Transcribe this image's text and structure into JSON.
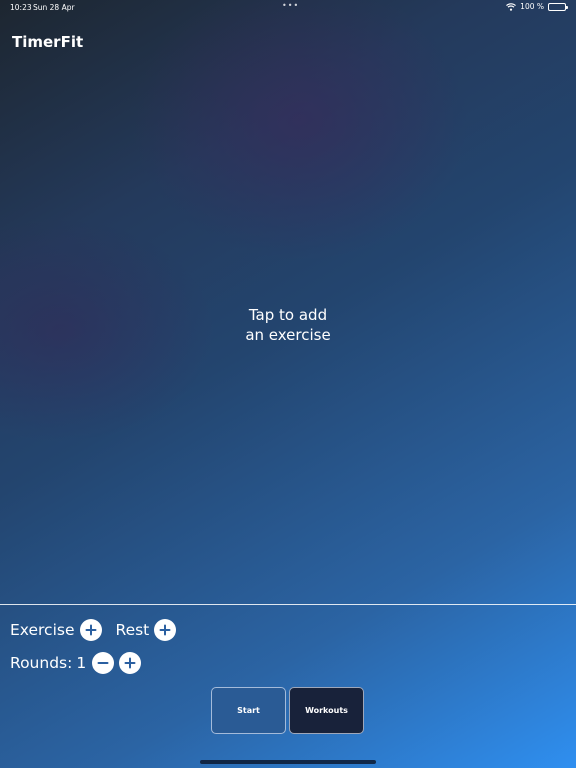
{
  "status_bar": {
    "time": "10:23",
    "date": "Sun 28 Apr",
    "dots": "•••",
    "battery": "100 %"
  },
  "app": {
    "title": "TimerFit"
  },
  "empty_state": {
    "line1": "Tap to add",
    "line2": "an exercise"
  },
  "controls": {
    "exercise_label": "Exercise",
    "rest_label": "Rest",
    "rounds_label": "Rounds:",
    "rounds_value": "1"
  },
  "buttons": {
    "start": "Start",
    "workouts": "Workouts"
  },
  "colors": {
    "accent_blue": "#2f8ff0",
    "start_button": "#2a5b95",
    "workouts_button": "#18223a"
  }
}
